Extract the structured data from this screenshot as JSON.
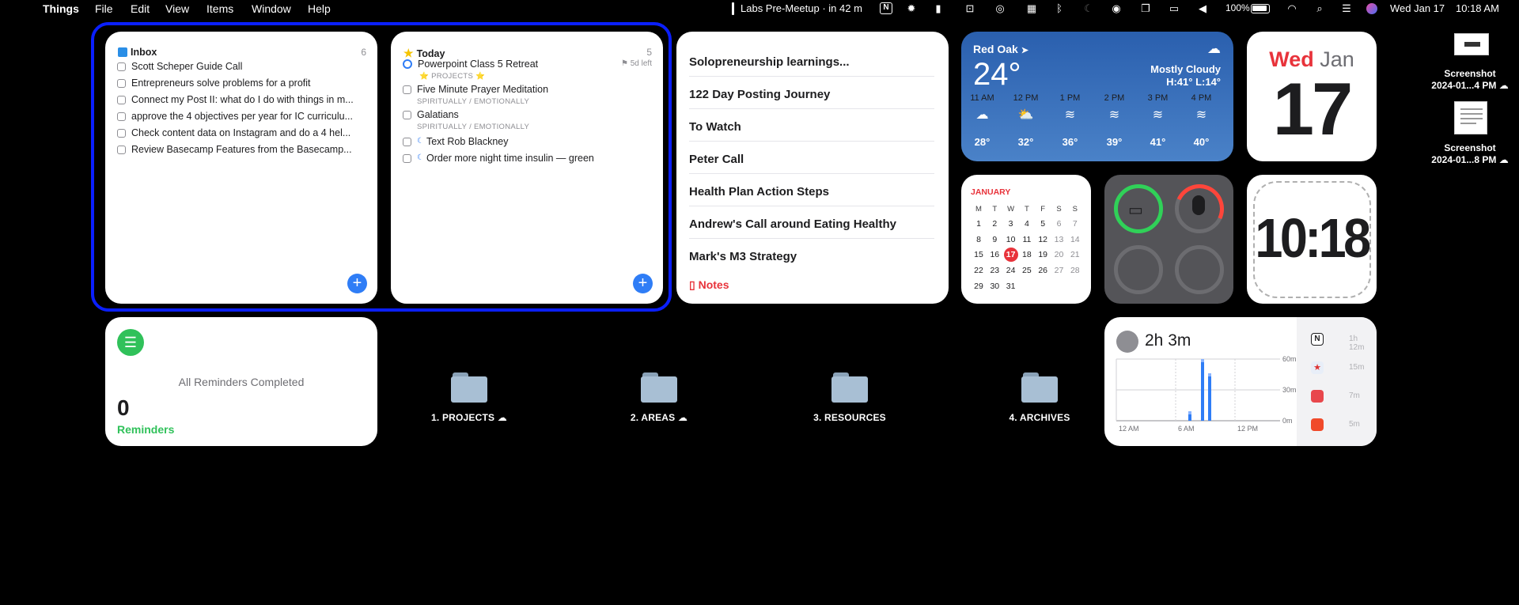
{
  "menubar": {
    "app_name": "Things",
    "menus": [
      "File",
      "Edit",
      "View",
      "Items",
      "Window",
      "Help"
    ],
    "status": {
      "meeting": "Labs Pre-Meetup · in 42 m",
      "battery": "100%",
      "date": "Wed Jan 17",
      "time": "10:18 AM"
    }
  },
  "inbox": {
    "title": "Inbox",
    "count": "6",
    "items": [
      "Scott Scheper Guide Call",
      "Entrepreneurs solve problems for a profit",
      "Connect my Post II: what do I do with things in m...",
      "approve the 4 objectives per year for IC curriculu...",
      "Check content data on Instagram and do a 4 hel...",
      "Review Basecamp Features from the Basecamp..."
    ]
  },
  "today": {
    "title": "Today",
    "count": "5",
    "items": [
      {
        "text": "Powerpoint Class 5 Retreat",
        "sub": "⭐ PROJECTS ⭐",
        "deadline": "5d left"
      },
      {
        "text": "Five Minute Prayer Meditation",
        "sub": "SPIRITUALLY / EMOTIONALLY"
      },
      {
        "text": "Galatians",
        "sub": "SPIRITUALLY / EMOTIONALLY"
      },
      {
        "text": "Text Rob Blackney",
        "sub": ""
      },
      {
        "text": "Order more night time insulin — green",
        "sub": ""
      }
    ]
  },
  "notes": {
    "items": [
      "Solopreneurship learnings...",
      "122 Day Posting Journey",
      "To Watch",
      "Peter Call",
      "Health Plan Action Steps",
      "Andrew's Call around Eating Healthy",
      "Mark's M3 Strategy"
    ],
    "footer": "Notes"
  },
  "weather": {
    "location": "Red Oak",
    "temp": "24°",
    "condition": "Mostly Cloudy",
    "hilo": "H:41° L:14°",
    "hours": [
      {
        "time": "11 AM",
        "temp": "28°"
      },
      {
        "time": "12 PM",
        "temp": "32°"
      },
      {
        "time": "1 PM",
        "temp": "36°"
      },
      {
        "time": "2 PM",
        "temp": "39°"
      },
      {
        "time": "3 PM",
        "temp": "41°"
      },
      {
        "time": "4 PM",
        "temp": "40°"
      }
    ]
  },
  "date_widget": {
    "weekday": "Wed",
    "month": "Jan",
    "day": "17"
  },
  "calendar": {
    "month": "JANUARY",
    "weekdays": [
      "M",
      "T",
      "W",
      "T",
      "F",
      "S",
      "S"
    ],
    "weeks": [
      [
        "1",
        "2",
        "3",
        "4",
        "5",
        "6",
        "7"
      ],
      [
        "8",
        "9",
        "10",
        "11",
        "12",
        "13",
        "14"
      ],
      [
        "15",
        "16",
        "17",
        "18",
        "19",
        "20",
        "21"
      ],
      [
        "22",
        "23",
        "24",
        "25",
        "26",
        "27",
        "28"
      ],
      [
        "29",
        "30",
        "31",
        "",
        "",
        "",
        ""
      ]
    ],
    "today": "17"
  },
  "clock": {
    "time": "10:18"
  },
  "reminders": {
    "status": "All Reminders Completed",
    "count": "0",
    "label": "Reminders"
  },
  "folders": [
    {
      "name": "1. PROJECTS",
      "cloud": "☁"
    },
    {
      "name": "2. AREAS",
      "cloud": "☁"
    },
    {
      "name": "3. RESOURCES",
      "cloud": ""
    },
    {
      "name": "4. ARCHIVES",
      "cloud": ""
    }
  ],
  "screen_time": {
    "total": "2h 3m",
    "y_labels": [
      "60m",
      "30m",
      "0m"
    ],
    "x_labels": [
      "12 AM",
      "6 AM",
      "12 PM"
    ],
    "apps": [
      {
        "time": "1h 12m",
        "color": "#1d1d1f"
      },
      {
        "time": "15m",
        "color": "#e8eef8"
      },
      {
        "time": "7m",
        "color": "#e8474c"
      },
      {
        "time": "5m",
        "color": "#f04a2a"
      }
    ]
  },
  "desktop": [
    {
      "label": "Screenshot",
      "date": "2024-01...4 PM"
    },
    {
      "label": "Screenshot",
      "date": "2024-01...8 PM"
    }
  ]
}
